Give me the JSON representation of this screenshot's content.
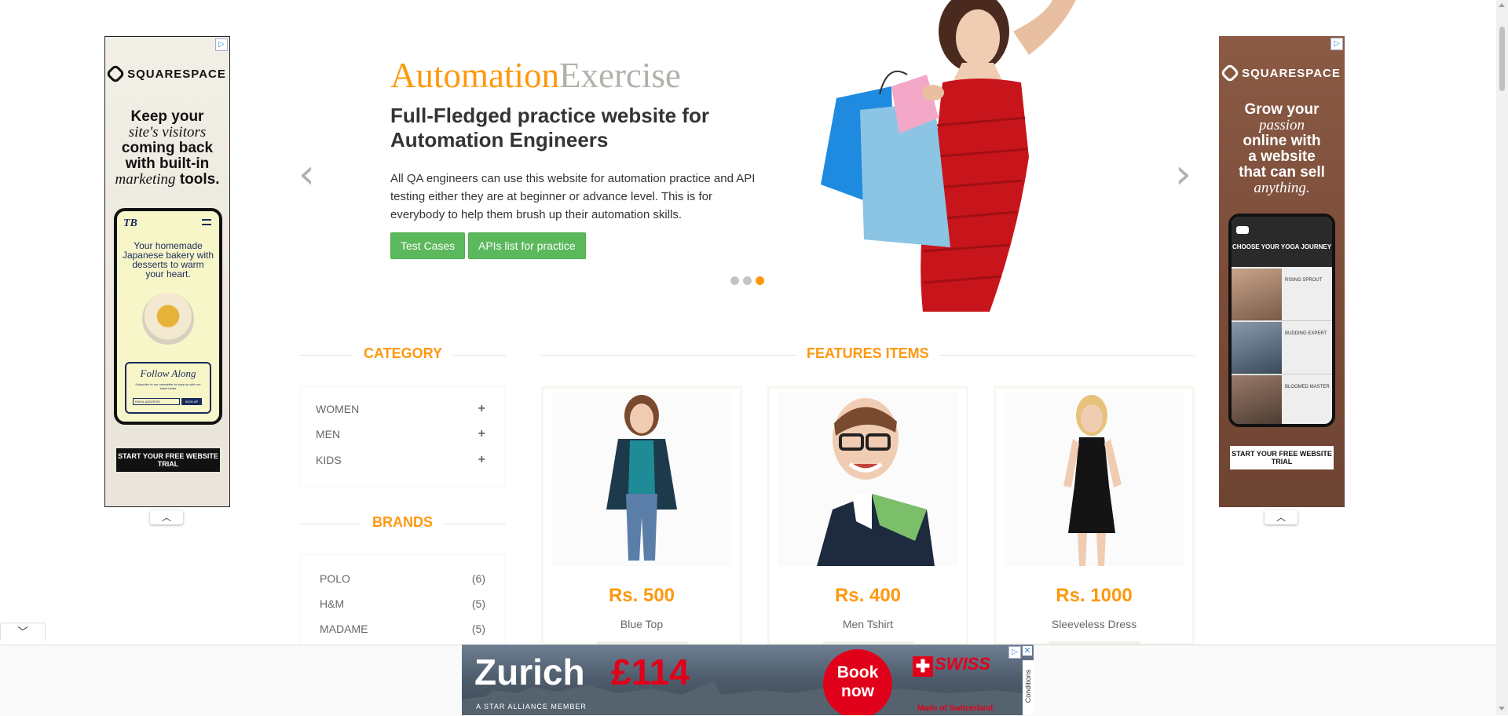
{
  "left_ad": {
    "brand": "SQUARESPACE",
    "headline_1": "Keep your",
    "headline_2": "site's visitors",
    "headline_3": "coming back",
    "headline_4": "with built-in",
    "headline_5": "marketing",
    "headline_6": "tools.",
    "phone_logo": "TB",
    "phone_text": "Your homemade Japanese bakery with desserts to warm your heart.",
    "follow": "Follow Along",
    "follow_small": "Subscribe to our newsletter to keep up with our latest treats",
    "email_placeholder": "EMAIL ADDRESS",
    "signup": "SIGN UP",
    "cta": "START YOUR FREE WEBSITE TRIAL"
  },
  "right_ad": {
    "brand": "SQUARESPACE",
    "headline_1": "Grow your",
    "headline_2": "passion",
    "headline_3": "online with",
    "headline_4": "a website",
    "headline_5": "that can sell",
    "headline_6": "anything.",
    "phone_title": "CHOOSE YOUR YOGA JOURNEY",
    "items": [
      "RISING SPROUT",
      "BUDDING EXPERT",
      "BLOOMED MASTER"
    ],
    "cta": "START YOUR FREE WEBSITE TRIAL"
  },
  "slider": {
    "brand_a": "Automation",
    "brand_b": "Exercise",
    "heading": "Full-Fledged practice website for Automation Engineers",
    "description": "All QA engineers can use this website for automation practice and API testing either they are at beginner or advance level. This is for everybody to help them brush up their automation skills.",
    "btn_test_cases": "Test Cases",
    "btn_apis": "APIs list for practice",
    "prev": "‹",
    "next": "›",
    "active_slide": 3,
    "slide_count": 3
  },
  "sidebar": {
    "category_title": "CATEGORY",
    "categories": [
      "WOMEN",
      "MEN",
      "KIDS"
    ],
    "plus": "+",
    "brands_title": "BRANDS",
    "brands": [
      {
        "name": "POLO",
        "count": "(6)"
      },
      {
        "name": "H&M",
        "count": "(5)"
      },
      {
        "name": "MADAME",
        "count": "(5)"
      }
    ]
  },
  "features": {
    "title": "FEATURES ITEMS",
    "products": [
      {
        "price": "Rs. 500",
        "name": "Blue Top"
      },
      {
        "price": "Rs. 400",
        "name": "Men Tshirt"
      },
      {
        "price": "Rs. 1000",
        "name": "Sleeveless Dress"
      }
    ]
  },
  "bottom_ad": {
    "city": "Zurich",
    "price": "£114",
    "book": "Book now",
    "airline": "SWISS",
    "alliance": "A STAR ALLIANCE MEMBER",
    "made_of": "Made of Switzerland.",
    "conditions": "Conditions"
  },
  "colors": {
    "accent": "#fe980f",
    "brand_grey": "#b4b1ab",
    "button_green": "#5cb85c",
    "text": "#696763",
    "swiss_red": "#e1001a"
  }
}
